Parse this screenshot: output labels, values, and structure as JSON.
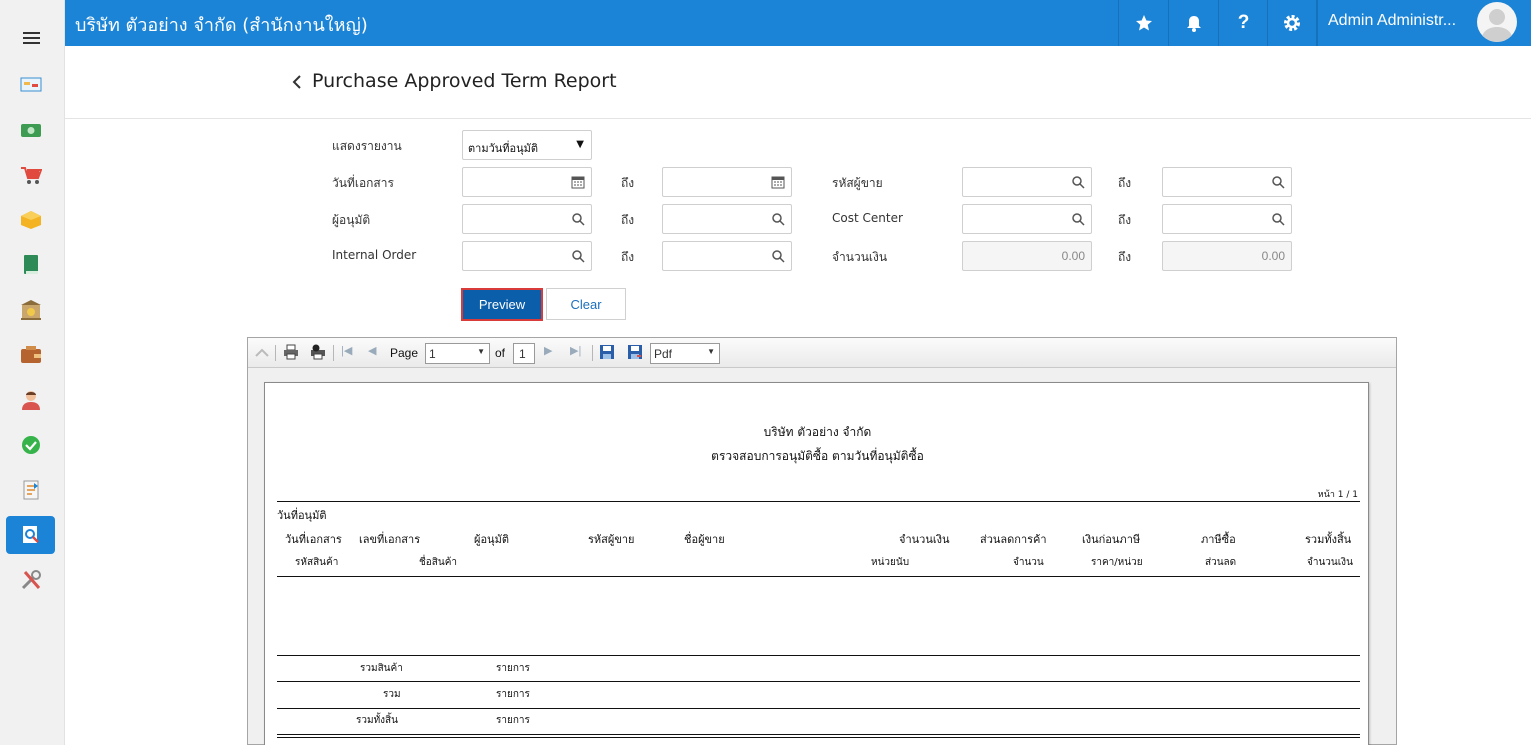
{
  "topbar": {
    "company": "บริษัท ตัวอย่าง จำกัด (สำนักงานใหญ่)",
    "user_name": "Admin Administr...",
    "brand_color": "#1b84d6"
  },
  "page": {
    "title": "Purchase Approved Term Report"
  },
  "form": {
    "report_type_label": "แสดงรายงาน",
    "report_type_value": "ตามวันที่อนุมัติ",
    "doc_date_label": "วันที่เอกสาร",
    "to_label": "ถึง",
    "vendor_code_label": "รหัสผู้ขาย",
    "approver_label": "ผู้อนุมัติ",
    "cost_center_label": "Cost Center",
    "internal_order_label": "Internal Order",
    "amount_label": "จำนวนเงิน",
    "amount_from": "0.00",
    "amount_to": "0.00",
    "preview_label": "Preview",
    "clear_label": "Clear"
  },
  "viewer": {
    "page_label": "Page",
    "page_value": "1",
    "of_label": "of",
    "total_pages": "1",
    "export_format": "Pdf"
  },
  "report": {
    "company": "บริษัท ตัวอย่าง จำกัด",
    "title": "ตรวจสอบการอนุมัติซื้อ ตามวันที่อนุมัติซื้อ",
    "page_info": "หน้า 1 / 1",
    "group_label": "วันที่อนุมัติ",
    "header_row1": [
      "วันที่เอกสาร",
      "เลขที่เอกสาร",
      "ผู้อนุมัติ",
      "รหัสผู้ขาย",
      "ชื่อผู้ขาย",
      "จำนวนเงิน",
      "ส่วนลดการค้า",
      "เงินก่อนภาษี",
      "ภาษีซื้อ",
      "รวมทั้งสิ้น"
    ],
    "header_row2": [
      "รหัสสินค้า",
      "ชื่อสินค้า",
      "หน่วยนับ",
      "จำนวน",
      "ราคา/หน่วย",
      "ส่วนลด",
      "จำนวนเงิน"
    ],
    "totals": [
      {
        "label": "รวมสินค้า",
        "unit": "รายการ"
      },
      {
        "label": "รวม",
        "unit": "รายการ"
      },
      {
        "label": "รวมทั้งสิ้น",
        "unit": "รายการ"
      }
    ]
  }
}
